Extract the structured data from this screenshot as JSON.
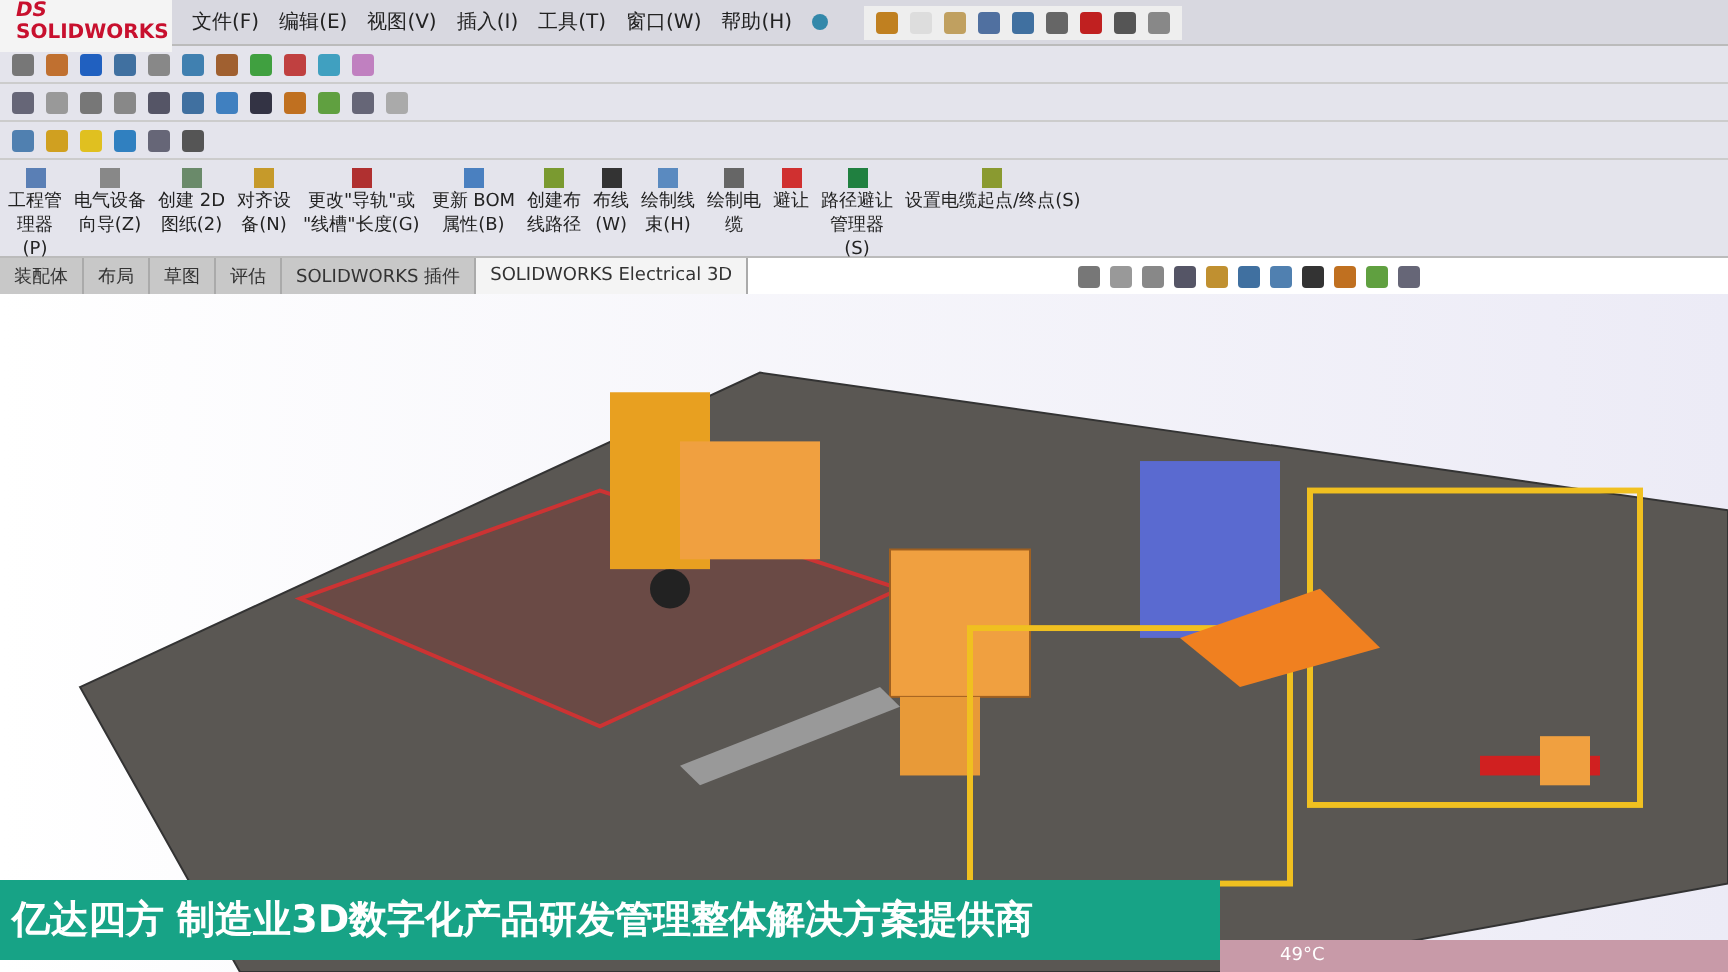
{
  "app": {
    "logo_mark": "DS",
    "logo": "SOLIDWORKS"
  },
  "menu": [
    "文件(F)",
    "编辑(E)",
    "视图(V)",
    "插入(I)",
    "工具(T)",
    "窗口(W)",
    "帮助(H)"
  ],
  "commands": [
    {
      "label": "工程管理器(P)"
    },
    {
      "label": "电气设备向导(Z)"
    },
    {
      "label": "创建 2D\n图纸(2)"
    },
    {
      "label": "对齐设备(N)"
    },
    {
      "label": "更改\"导轨\"或\n\"线槽\"长度(G)"
    },
    {
      "label": "更新 BOM\n属性(B)"
    },
    {
      "label": "创建布线路径"
    },
    {
      "label": "布线\n(W)"
    },
    {
      "label": "绘制线束(H)"
    },
    {
      "label": "绘制电缆"
    },
    {
      "label": "避让"
    },
    {
      "label": "路径避让管理器(S)"
    },
    {
      "label": "设置电缆起点/终点(S)"
    }
  ],
  "tabs": [
    {
      "label": "装配体",
      "selected": false
    },
    {
      "label": "布局",
      "selected": false
    },
    {
      "label": "草图",
      "selected": false
    },
    {
      "label": "评估",
      "selected": false
    },
    {
      "label": "SOLIDWORKS 插件",
      "selected": false
    },
    {
      "label": "SOLIDWORKS Electrical 3D",
      "selected": true
    }
  ],
  "banner": {
    "text": "亿达四方 制造业3D数字化产品研发管理整体解决方案提供商"
  },
  "taskbar": {
    "temperature": "49°C"
  }
}
